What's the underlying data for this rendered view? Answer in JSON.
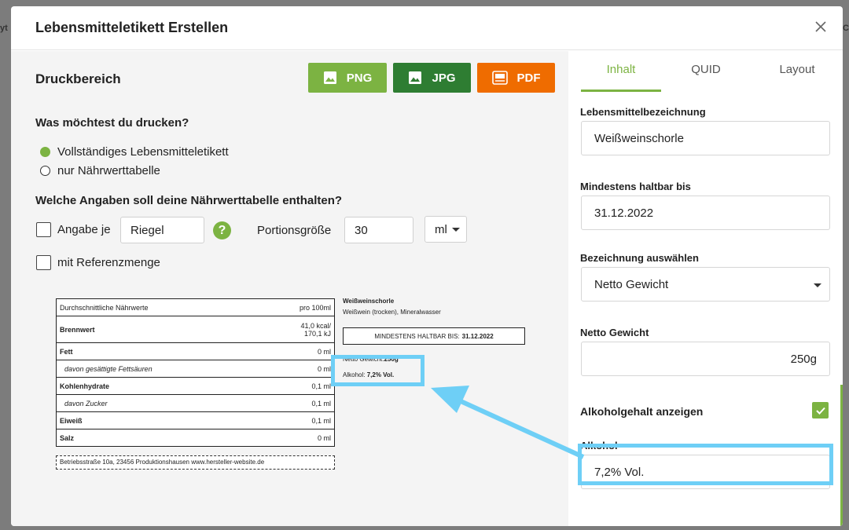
{
  "modal": {
    "title": "Lebensmitteletikett Erstellen"
  },
  "left": {
    "section_title": "Druckbereich",
    "export_buttons": {
      "png": "PNG",
      "jpg": "JPG",
      "pdf": "PDF"
    },
    "print_question": "Was möchtest du drucken?",
    "radio_full": "Vollständiges Lebensmitteletikett",
    "radio_table": "nur Nährwerttabelle",
    "table_question": "Welche Angaben soll deine Nährwerttabelle enthalten?",
    "angabe_je_label": "Angabe je",
    "angabe_je_value": "Riegel",
    "portion_label": "Portionsgröße",
    "portion_value": "30",
    "unit_value": "ml",
    "referenz_label": "mit Referenzmenge"
  },
  "preview": {
    "table_header": "Durchschnittliche Nährwerte",
    "table_header_unit": "pro 100ml",
    "rows": [
      {
        "label": "Brennwert",
        "value_line1": "41,0 kcal/",
        "value_line2": "170,1 kJ"
      },
      {
        "label": "Fett",
        "value": "0 ml"
      },
      {
        "label": "davon gesättigte Fettsäuren",
        "value": "0 ml"
      },
      {
        "label": "Kohlenhydrate",
        "value": "0,1 ml"
      },
      {
        "label": "davon Zucker",
        "value": "0,1 ml"
      },
      {
        "label": "Eiweiß",
        "value": "0,1 ml"
      },
      {
        "label": "Salz",
        "value": "0 ml"
      }
    ],
    "address": "Betriebsstraße 10a, 23456 Produktionshausen www.hersteller-website.de",
    "product_name": "Weißweinschorle",
    "ingredients": "Weißwein (trocken), Mineralwasser",
    "mhd_label": "MINDESTENS HALTBAR BIS:",
    "mhd_value": "31.12.2022",
    "netto_label": "Netto Gewicht:",
    "netto_value": "250g",
    "alcohol_label": "Alkohol:",
    "alcohol_value": "7,2% Vol."
  },
  "right": {
    "tabs": [
      "Inhalt",
      "QUID",
      "Layout"
    ],
    "name_label": "Lebensmittelbezeichnung",
    "name_value": "Weißweinschorle",
    "mhd_label": "Mindestens haltbar bis",
    "mhd_value": "31.12.2022",
    "designation_label": "Bezeichnung auswählen",
    "designation_value": "Netto Gewicht",
    "netto_label": "Netto Gewicht",
    "netto_value": "250g",
    "alcohol_toggle_label": "Alkoholgehalt anzeigen",
    "alcohol_label": "Alkohol",
    "alcohol_value": "7,2% Vol."
  },
  "colors": {
    "brand_green": "#7cb342",
    "jpg_green": "#2e7d32",
    "pdf_orange": "#ef6c00",
    "highlight_blue": "#6ecff6"
  }
}
